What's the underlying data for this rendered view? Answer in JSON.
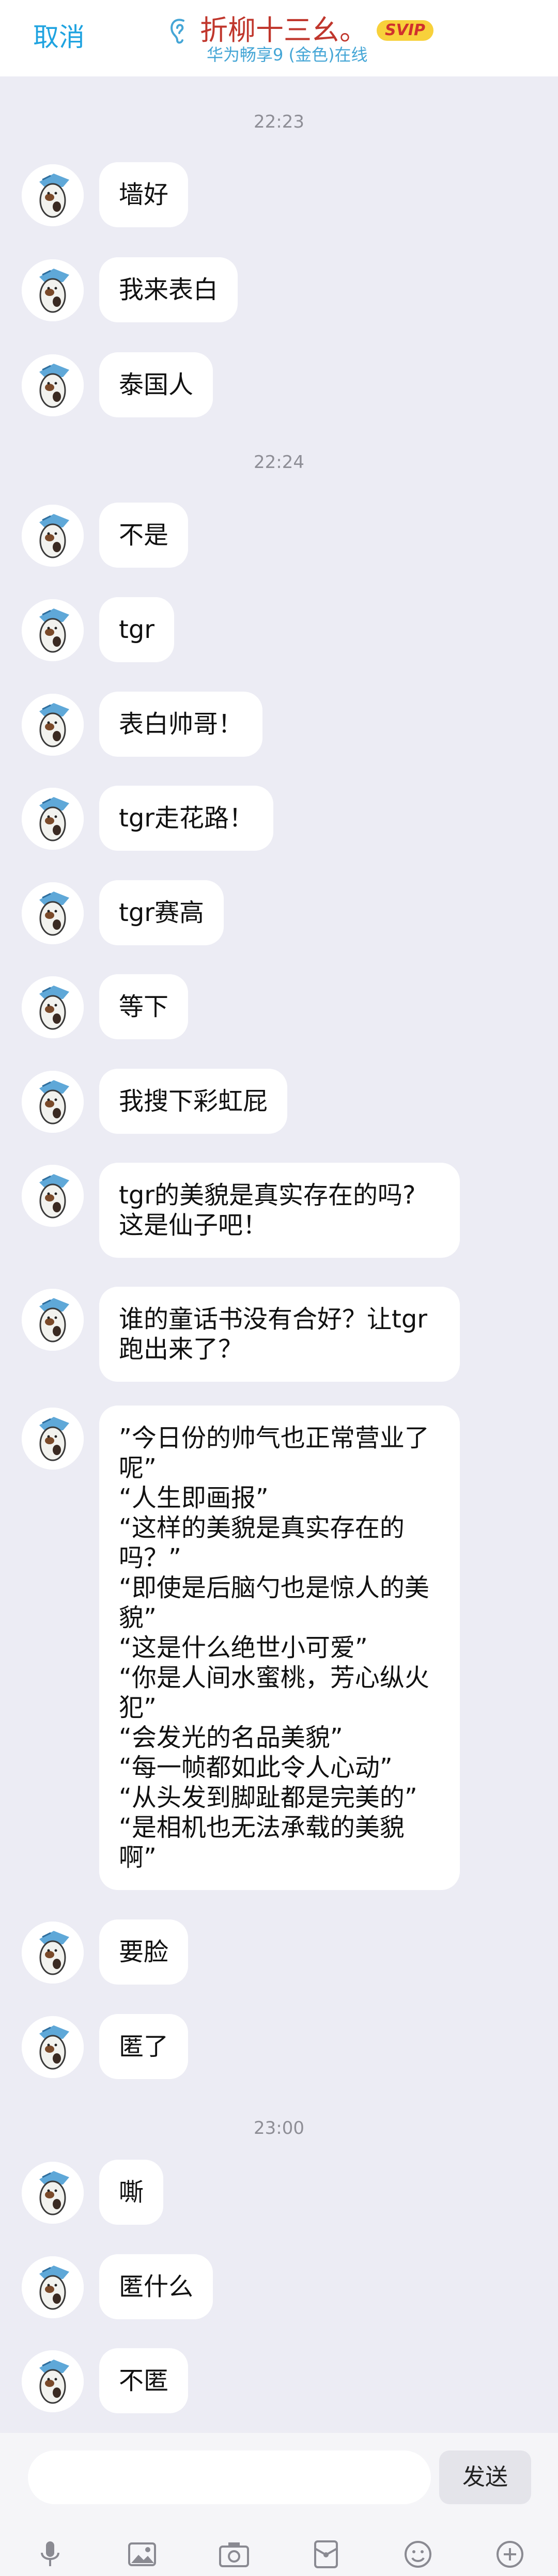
{
  "header": {
    "cancel_label": "取消",
    "title": "折柳十三幺。",
    "badge": "SVIP",
    "subtitle": "华为畅享9 (金色)在线"
  },
  "timestamps": [
    "22:23",
    "22:24",
    "23:00"
  ],
  "messages": [
    {
      "text": "墙好"
    },
    {
      "text": "我来表白"
    },
    {
      "text": "泰国人"
    },
    {
      "text": "不是"
    },
    {
      "text": "tgr"
    },
    {
      "text": "表白帅哥！"
    },
    {
      "text": "tgr走花路！"
    },
    {
      "text": "tgr赛高"
    },
    {
      "text": "等下"
    },
    {
      "text": "我搜下彩虹屁"
    },
    {
      "lines": [
        "tgr的美貌是真实存在的吗?",
        "这是仙子吧！"
      ]
    },
    {
      "lines": [
        "谁的童话书没有合好？让tgr",
        "跑出来了？"
      ]
    },
    {
      "lines": [
        "”今日份的帅气也正常营业了",
        "呢”",
        "“人生即画报”",
        "“这样的美貌是真实存在的",
        "吗？”",
        "“即使是后脑勺也是惊人的美",
        "貌”",
        "“这是什么绝世小可爱”",
        "“你是人间水蜜桃，芳心纵火",
        "犯”",
        "“会发光的名品美貌”",
        "“每一帧都如此令人心动”",
        "“从头发到脚趾都是完美的”",
        "“是相机也无法承载的美貌",
        "啊”"
      ]
    },
    {
      "text": "要脸"
    },
    {
      "text": "匿了"
    },
    {
      "text": "嘶"
    },
    {
      "text": "匿什么"
    },
    {
      "text": "不匿"
    }
  ],
  "input": {
    "value": "",
    "send_label": "发送"
  },
  "toolbar": {
    "icons": [
      "microphone-icon",
      "image-icon",
      "camera-icon",
      "red-packet-icon",
      "emoji-icon",
      "plus-icon"
    ]
  },
  "colors": {
    "accent": "#1FA3E0",
    "title_red": "#C0362C",
    "svip_yellow": "#F8D13B",
    "background": "#ECECF4"
  }
}
